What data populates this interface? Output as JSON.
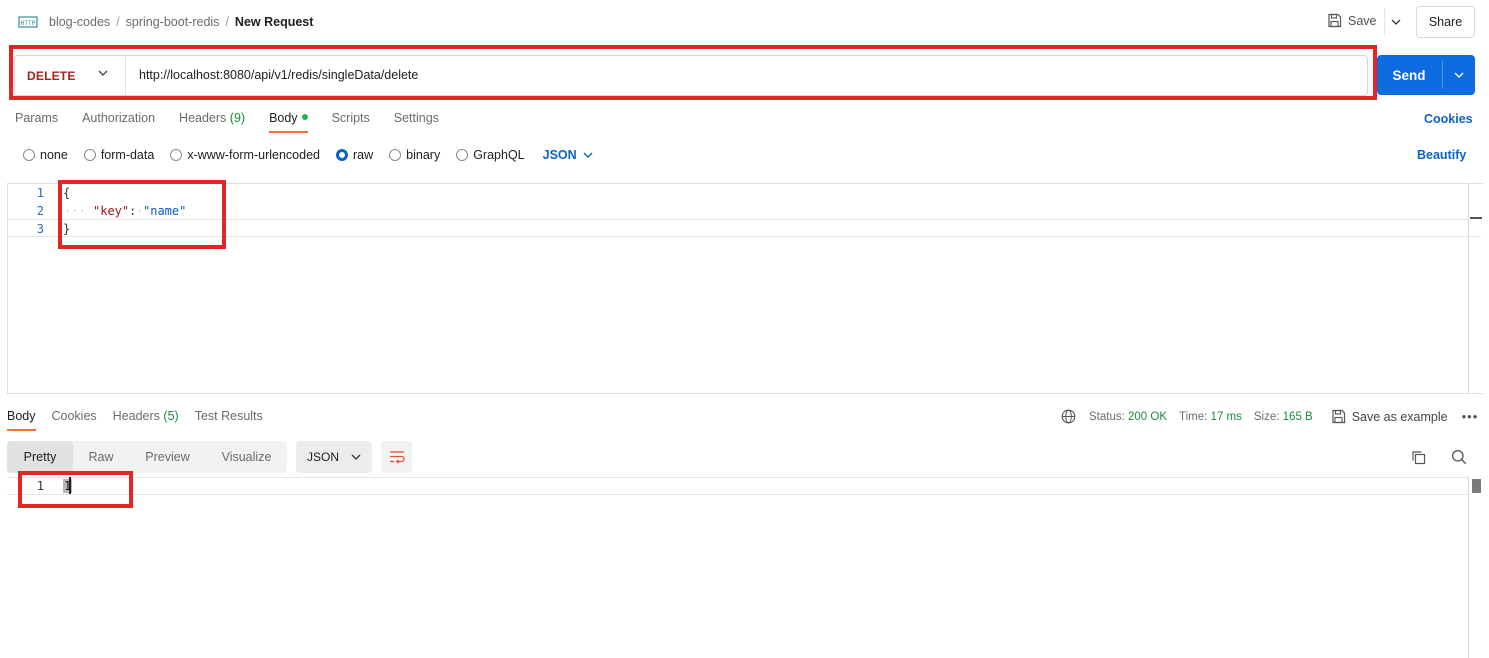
{
  "breadcrumb": {
    "items": [
      "blog-codes",
      "spring-boot-redis"
    ],
    "current": "New Request",
    "separator": "/"
  },
  "header": {
    "save_label": "Save",
    "share_label": "Share"
  },
  "request": {
    "method": "DELETE",
    "url": "http://localhost:8080/api/v1/redis/singleData/delete",
    "send_label": "Send"
  },
  "request_tabs": {
    "params": "Params",
    "authorization": "Authorization",
    "headers_label": "Headers",
    "headers_count": "(9)",
    "body": "Body",
    "scripts": "Scripts",
    "settings": "Settings",
    "cookies": "Cookies"
  },
  "body_types": {
    "none": "none",
    "form_data": "form-data",
    "urlencoded": "x-www-form-urlencoded",
    "raw": "raw",
    "binary": "binary",
    "graphql": "GraphQL",
    "selected": "raw",
    "format": "JSON",
    "beautify": "Beautify"
  },
  "request_body": {
    "line_numbers": [
      "1",
      "2",
      "3"
    ],
    "open_brace": "{",
    "key": "\"key\"",
    "colon": ":",
    "value": "\"name\"",
    "close_brace": "}"
  },
  "response_tabs": {
    "body": "Body",
    "cookies": "Cookies",
    "headers_label": "Headers",
    "headers_count": "(5)",
    "test_results": "Test Results"
  },
  "response_status": {
    "status_label": "Status:",
    "status_value": "200 OK",
    "time_label": "Time:",
    "time_value": "17 ms",
    "size_label": "Size:",
    "size_value": "165 B",
    "save_example": "Save as example",
    "more": "•••"
  },
  "response_view": {
    "modes": [
      "Pretty",
      "Raw",
      "Preview",
      "Visualize"
    ],
    "active_mode": "Pretty",
    "format": "JSON"
  },
  "response_body": {
    "line_number": "1",
    "value": "1"
  },
  "colors": {
    "accent": "#0c6ce0",
    "method_delete": "#a0261e",
    "status_ok": "#1b8b3a",
    "active_tab_underline": "#ff6c37",
    "annotation_red": "#e32525"
  },
  "icons": {
    "app": "http-icon",
    "save": "floppy-disk-icon",
    "globe": "globe-icon",
    "copy": "copy-icon",
    "search": "search-icon",
    "wrap": "wrap-lines-icon"
  }
}
